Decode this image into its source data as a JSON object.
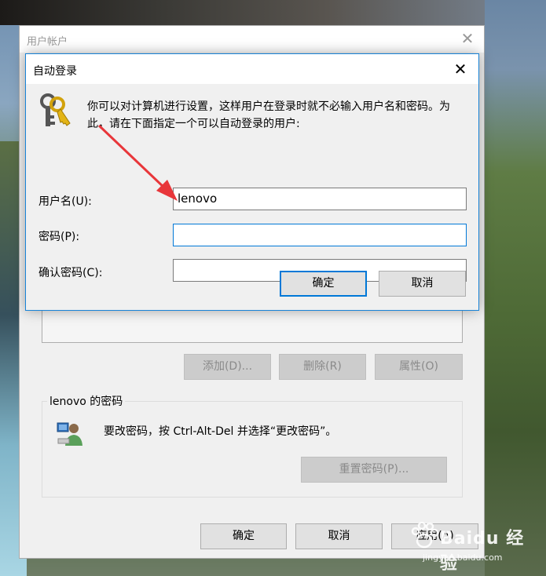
{
  "outer_window": {
    "title": "用户帐户",
    "add_button": "添加(D)...",
    "remove_button": "删除(R)",
    "properties_button": "属性(O)",
    "password_group_title": "lenovo 的密码",
    "password_message": "要改密码，按 Ctrl-Alt-Del 并选择“更改密码”。",
    "reset_password_button": "重置密码(P)...",
    "ok_button": "确定",
    "cancel_button": "取消",
    "apply_button": "应用(A)"
  },
  "dialog": {
    "title": "自动登录",
    "description": "你可以对计算机进行设置，这样用户在登录时就不必输入用户名和密码。为此，请在下面指定一个可以自动登录的用户:",
    "username_label": "用户名(U):",
    "username_value": "lenovo",
    "password_label": "密码(P):",
    "password_value": "",
    "confirm_label": "确认密码(C):",
    "confirm_value": "",
    "ok_button": "确定",
    "cancel_button": "取消"
  },
  "watermark": {
    "main": "Baidu 经验",
    "sub": "jingyan.baidu.com"
  },
  "colors": {
    "accent": "#0078d7",
    "arrow": "#e8363a"
  }
}
